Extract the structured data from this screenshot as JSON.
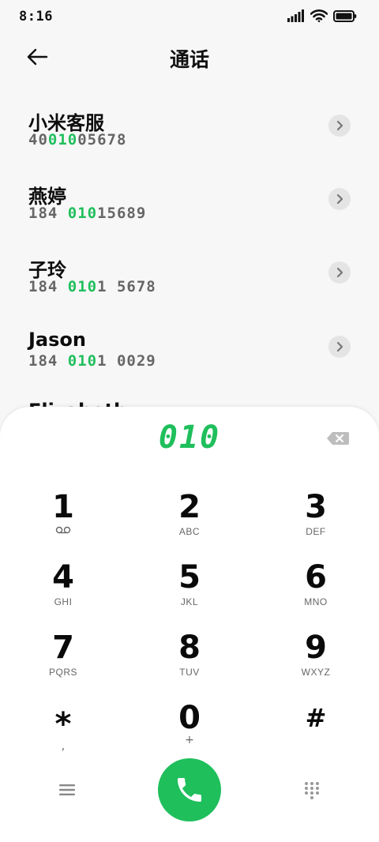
{
  "status_bar": {
    "time": "8:16"
  },
  "header": {
    "title": "通话"
  },
  "contacts": [
    {
      "name": "小米客服",
      "number_pre": "40",
      "number_match": "010",
      "number_post": "05678"
    },
    {
      "name": "燕婷",
      "number_pre": "184 ",
      "number_match": "010",
      "number_post": "15689"
    },
    {
      "name": "子玲",
      "number_pre": "184 ",
      "number_match": "010",
      "number_post": "1 5678"
    },
    {
      "name": "Jason",
      "number_pre": "184 ",
      "number_match": "010",
      "number_post": "1 0029"
    }
  ],
  "partial_contact_name": "Elizabeth",
  "dialpad": {
    "input": "010",
    "keys": [
      {
        "digit": "1",
        "letters": "",
        "icon": "voicemail-icon"
      },
      {
        "digit": "2",
        "letters": "ABC"
      },
      {
        "digit": "3",
        "letters": "DEF"
      },
      {
        "digit": "4",
        "letters": "GHI"
      },
      {
        "digit": "5",
        "letters": "JKL"
      },
      {
        "digit": "6",
        "letters": "MNO"
      },
      {
        "digit": "7",
        "letters": "PQRS"
      },
      {
        "digit": "8",
        "letters": "TUV"
      },
      {
        "digit": "9",
        "letters": "WXYZ"
      },
      {
        "digit": "*",
        "letters": ","
      },
      {
        "digit": "0",
        "letters": "+"
      },
      {
        "digit": "#",
        "letters": ""
      }
    ]
  },
  "colors": {
    "accent": "#1fbf5c",
    "background": "#f7f7f7",
    "panel": "#ffffff"
  }
}
